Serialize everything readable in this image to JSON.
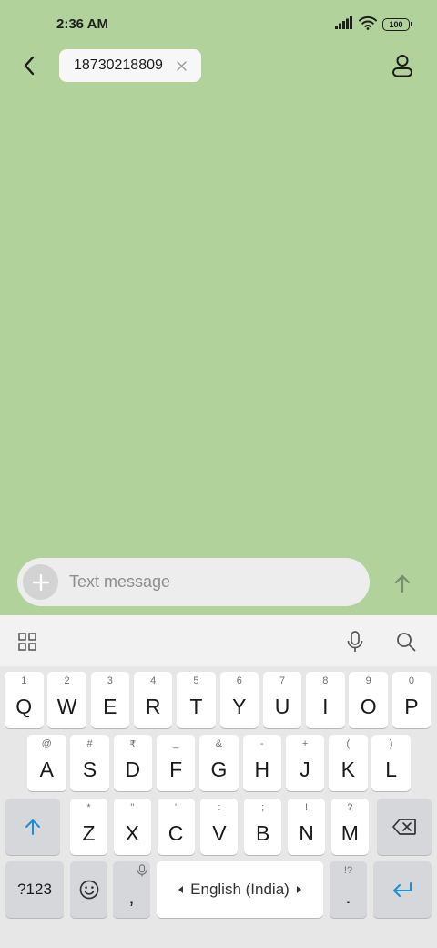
{
  "status": {
    "time": "2:36 AM",
    "battery_level": "100",
    "icons": [
      "signal-icon",
      "wifi-icon",
      "battery-icon"
    ]
  },
  "header": {
    "recipient": "18730218809",
    "icons": [
      "back-arrow-icon",
      "close-icon",
      "contact-icon"
    ]
  },
  "compose": {
    "placeholder": "Text message",
    "icons": [
      "plus-icon",
      "send-arrow-icon"
    ]
  },
  "keyboard": {
    "toolbar_icons": [
      "grid-icon",
      "microphone-icon",
      "search-icon"
    ],
    "row1": [
      {
        "key": "Q",
        "hint": "1"
      },
      {
        "key": "W",
        "hint": "2"
      },
      {
        "key": "E",
        "hint": "3"
      },
      {
        "key": "R",
        "hint": "4"
      },
      {
        "key": "T",
        "hint": "5"
      },
      {
        "key": "Y",
        "hint": "6"
      },
      {
        "key": "U",
        "hint": "7"
      },
      {
        "key": "I",
        "hint": "8"
      },
      {
        "key": "O",
        "hint": "9"
      },
      {
        "key": "P",
        "hint": "0"
      }
    ],
    "row2": [
      {
        "key": "A",
        "hint": "@"
      },
      {
        "key": "S",
        "hint": "#"
      },
      {
        "key": "D",
        "hint": "₹"
      },
      {
        "key": "F",
        "hint": "_"
      },
      {
        "key": "G",
        "hint": "&"
      },
      {
        "key": "H",
        "hint": "-"
      },
      {
        "key": "J",
        "hint": "+"
      },
      {
        "key": "K",
        "hint": "("
      },
      {
        "key": "L",
        "hint": ")"
      }
    ],
    "row3": [
      {
        "key": "Z",
        "hint": "*"
      },
      {
        "key": "X",
        "hint": "\""
      },
      {
        "key": "C",
        "hint": "'"
      },
      {
        "key": "V",
        "hint": ":"
      },
      {
        "key": "B",
        "hint": ";"
      },
      {
        "key": "N",
        "hint": "!"
      },
      {
        "key": "M",
        "hint": "?"
      }
    ],
    "symbols_label": "?123",
    "comma": ",",
    "space_label": "English (India)",
    "period": ".",
    "period_hint": "!?",
    "accent_color": "#1a8fd6"
  }
}
